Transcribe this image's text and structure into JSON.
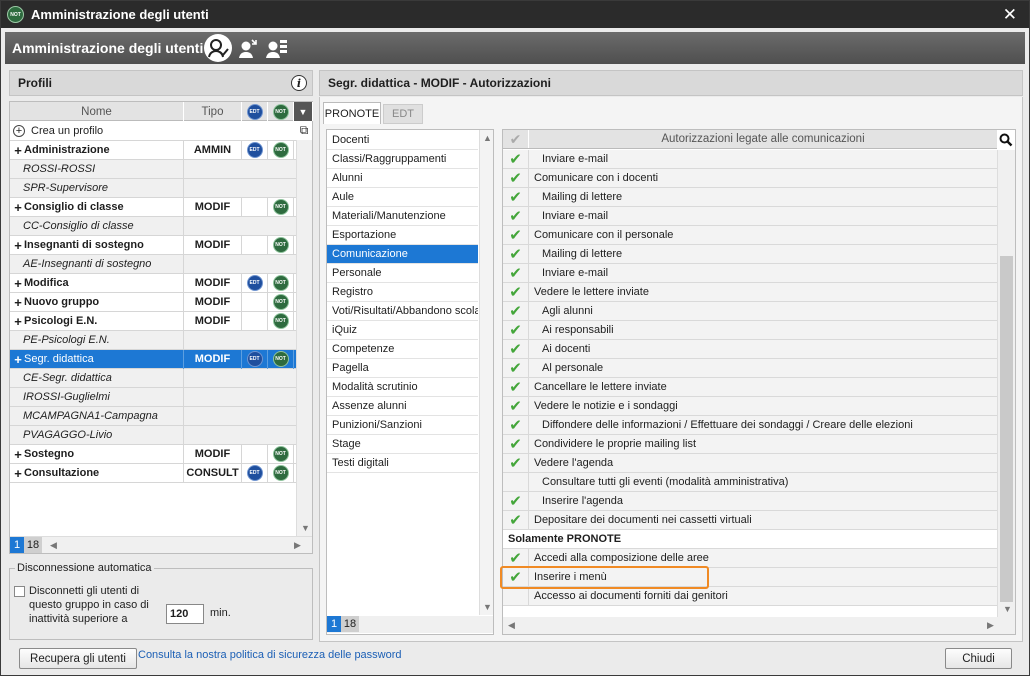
{
  "window": {
    "title": "Amministrazione degli utenti",
    "logo": "NOT",
    "close_icon": "close-icon"
  },
  "toolbar": {
    "title": "Amministrazione degli utenti",
    "icons": [
      "users-profile-icon",
      "users-transfer-icon",
      "users-list-icon"
    ]
  },
  "profiles": {
    "header": "Profili",
    "columns": {
      "nome": "Nome",
      "tipo": "Tipo",
      "edt": "EDT",
      "not": "NOT"
    },
    "create": "Crea un profilo",
    "rows": [
      {
        "kind": "grp",
        "name": "Administrazione",
        "tipo": "AMMIN",
        "edt": true,
        "not": true
      },
      {
        "kind": "sub",
        "name": "ROSSI-ROSSI"
      },
      {
        "kind": "sub",
        "name": "SPR-Supervisore"
      },
      {
        "kind": "grp",
        "name": "Consiglio di classe",
        "tipo": "MODIF",
        "edt": false,
        "not": true
      },
      {
        "kind": "sub",
        "name": "CC-Consiglio di classe"
      },
      {
        "kind": "grp",
        "name": "Insegnanti di sostegno",
        "tipo": "MODIF",
        "edt": false,
        "not": true
      },
      {
        "kind": "sub",
        "name": "AE-Insegnanti di sostegno"
      },
      {
        "kind": "grp",
        "name": "Modifica",
        "tipo": "MODIF",
        "edt": true,
        "not": true
      },
      {
        "kind": "grp",
        "name": "Nuovo gruppo",
        "tipo": "MODIF",
        "edt": false,
        "not": true
      },
      {
        "kind": "grp",
        "name": "Psicologi E.N.",
        "tipo": "MODIF",
        "edt": false,
        "not": true
      },
      {
        "kind": "sub",
        "name": "PE-Psicologi E.N."
      },
      {
        "kind": "sel",
        "name": "Segr. didattica",
        "tipo": "MODIF",
        "edt": true,
        "not": true
      },
      {
        "kind": "sub",
        "name": "CE-Segr. didattica"
      },
      {
        "kind": "sub",
        "name": "IROSSI-Guglielmi"
      },
      {
        "kind": "sub",
        "name": "MCAMPAGNA1-Campagna"
      },
      {
        "kind": "sub",
        "name": "PVAGAGGO-Livio"
      },
      {
        "kind": "grp",
        "name": "Sostegno",
        "tipo": "MODIF",
        "edt": false,
        "not": true
      },
      {
        "kind": "grp",
        "name": "Consultazione",
        "tipo": "CONSULT",
        "edt": true,
        "not": true
      }
    ],
    "pager": {
      "current": "1",
      "total": "18"
    }
  },
  "auto_disconnect": {
    "legend": "Disconnessione automatica",
    "text": "Disconnetti gli utenti di questo gruppo in caso di inattività superiore a",
    "value": "120",
    "unit": "min."
  },
  "footer": {
    "recover": "Recupera gli utenti",
    "policy_link": "Consulta la nostra politica di sicurezza delle password",
    "close": "Chiudi"
  },
  "right": {
    "header": "Segr. didattica - MODIF - Autorizzazioni",
    "tabs": [
      "PRONOTE",
      "EDT"
    ],
    "categories": [
      "Docenti",
      "Classi/Raggruppamenti",
      "Alunni",
      "Aule",
      "Materiali/Manutenzione",
      "Esportazione",
      "Comunicazione",
      "Personale",
      "Registro",
      "Voti/Risultati/Abbandono scolastico",
      "iQuiz",
      "Competenze",
      "Pagella",
      "Modalità scrutinio",
      "Assenze alunni",
      "Punizioni/Sanzioni",
      "Stage",
      "Testi digitali"
    ],
    "selected_category": "Comunicazione",
    "cat_pager": {
      "current": "1",
      "total": "18"
    },
    "perm_header": "Autorizzazioni legate alle comunicazioni",
    "permissions": [
      {
        "label": "Inviare e-mail",
        "level": 2,
        "checked": true
      },
      {
        "label": "Comunicare con i docenti",
        "level": 1,
        "checked": true
      },
      {
        "label": "Mailing di lettere",
        "level": 2,
        "checked": true
      },
      {
        "label": "Inviare e-mail",
        "level": 2,
        "checked": true
      },
      {
        "label": "Comunicare con il personale",
        "level": 1,
        "checked": true
      },
      {
        "label": "Mailing di lettere",
        "level": 2,
        "checked": true
      },
      {
        "label": "Inviare e-mail",
        "level": 2,
        "checked": true
      },
      {
        "label": "Vedere le lettere inviate",
        "level": 1,
        "checked": true
      },
      {
        "label": "Agli alunni",
        "level": 2,
        "checked": true
      },
      {
        "label": "Ai responsabili",
        "level": 2,
        "checked": true
      },
      {
        "label": "Ai docenti",
        "level": 2,
        "checked": true
      },
      {
        "label": "Al personale",
        "level": 2,
        "checked": true
      },
      {
        "label": "Cancellare le lettere inviate",
        "level": 1,
        "checked": true
      },
      {
        "label": "Vedere le notizie e i sondaggi",
        "level": 1,
        "checked": true
      },
      {
        "label": "Diffondere delle informazioni / Effettuare dei sondaggi / Creare delle elezioni",
        "level": 2,
        "checked": true
      },
      {
        "label": "Condividere le proprie mailing list",
        "level": 1,
        "checked": true
      },
      {
        "label": "Vedere l'agenda",
        "level": 1,
        "checked": true
      },
      {
        "label": "Consultare tutti gli eventi (modalità amministrativa)",
        "level": 2,
        "checked": false
      },
      {
        "label": "Inserire l'agenda",
        "level": 2,
        "checked": true
      },
      {
        "label": "Depositare dei documenti nei cassetti virtuali",
        "level": 1,
        "checked": true
      },
      {
        "label": "Solamente PRONOTE",
        "level": 0,
        "checked": false,
        "header": true
      },
      {
        "label": "Accedi alla composizione delle aree",
        "level": 1,
        "checked": true
      },
      {
        "label": "Inserire i menù",
        "level": 1,
        "checked": true
      },
      {
        "label": "Accesso ai documenti forniti dai genitori",
        "level": 1,
        "checked": false
      }
    ]
  }
}
